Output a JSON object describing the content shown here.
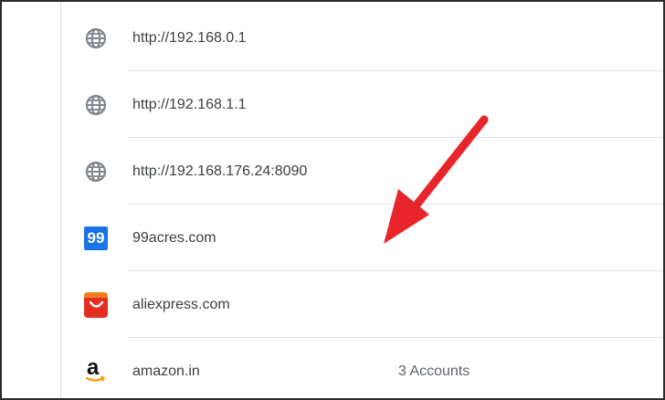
{
  "password_list": {
    "rows": [
      {
        "site": "http://192.168.0.1",
        "icon": "globe-icon",
        "accounts": ""
      },
      {
        "site": "http://192.168.1.1",
        "icon": "globe-icon",
        "accounts": ""
      },
      {
        "site": "http://192.168.176.24:8090",
        "icon": "globe-icon",
        "accounts": ""
      },
      {
        "site": "99acres.com",
        "icon": "99acres-logo-icon",
        "icon_text": "99",
        "accounts": ""
      },
      {
        "site": "aliexpress.com",
        "icon": "aliexpress-logo-icon",
        "accounts": ""
      },
      {
        "site": "amazon.in",
        "icon": "amazon-logo-icon",
        "icon_text": "a",
        "accounts": "3 Accounts"
      }
    ]
  },
  "colors": {
    "globe_icon": "#80868b",
    "icon_99_bg": "#1a73e8",
    "aliexpress_red": "#e62e20",
    "arrow_red": "#e8252a",
    "divider": "#e0e0e0"
  }
}
